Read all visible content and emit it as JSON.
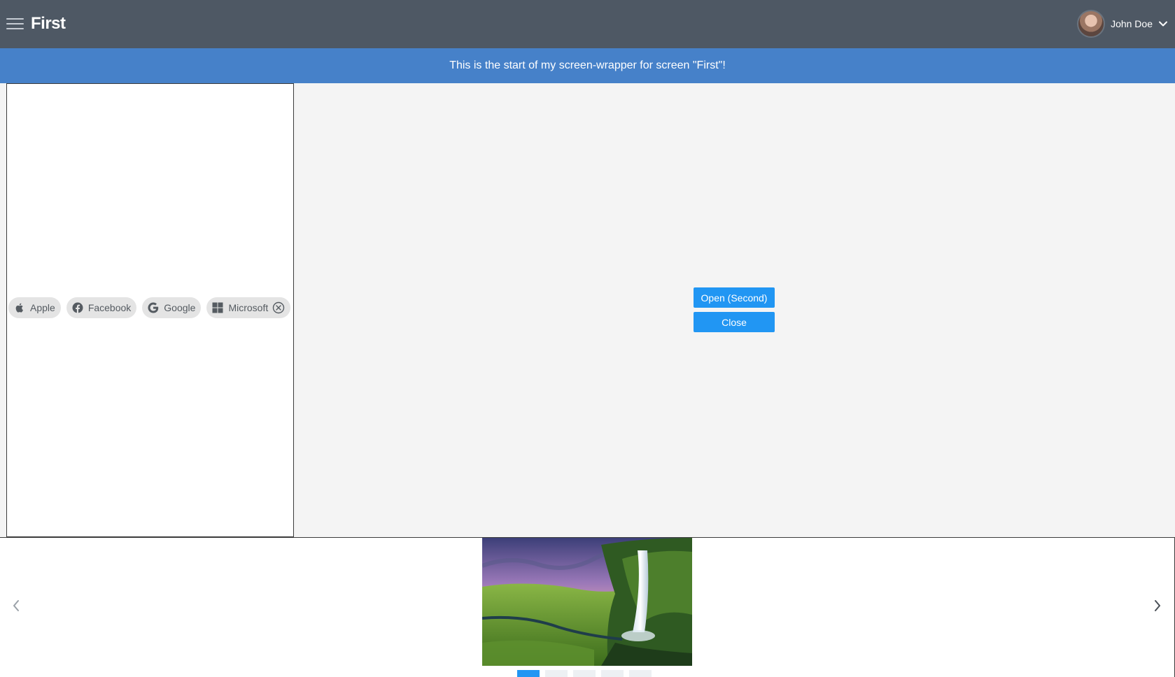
{
  "header": {
    "menu_icon": "hamburger-icon",
    "title": "First",
    "user": {
      "name": "John Doe",
      "dropdown_icon": "chevron-down-icon"
    }
  },
  "banner": {
    "text": "This is the start of my screen-wrapper for screen \"First\"!"
  },
  "chips": [
    {
      "label": "Apple",
      "icon": "apple-icon"
    },
    {
      "label": "Facebook",
      "icon": "facebook-icon"
    },
    {
      "label": "Google",
      "icon": "google-icon"
    },
    {
      "label": "Microsoft",
      "icon": "microsoft-icon",
      "removable": true
    }
  ],
  "actions": {
    "open_label": "Open (Second)",
    "close_label": "Close"
  },
  "carousel": {
    "prev_icon": "chevron-left-icon",
    "next_icon": "chevron-right-icon",
    "slide_count": 5,
    "active_index": 0
  },
  "colors": {
    "topbar": "#4e5864",
    "banner": "#4681c9",
    "primary": "#2196f3"
  }
}
